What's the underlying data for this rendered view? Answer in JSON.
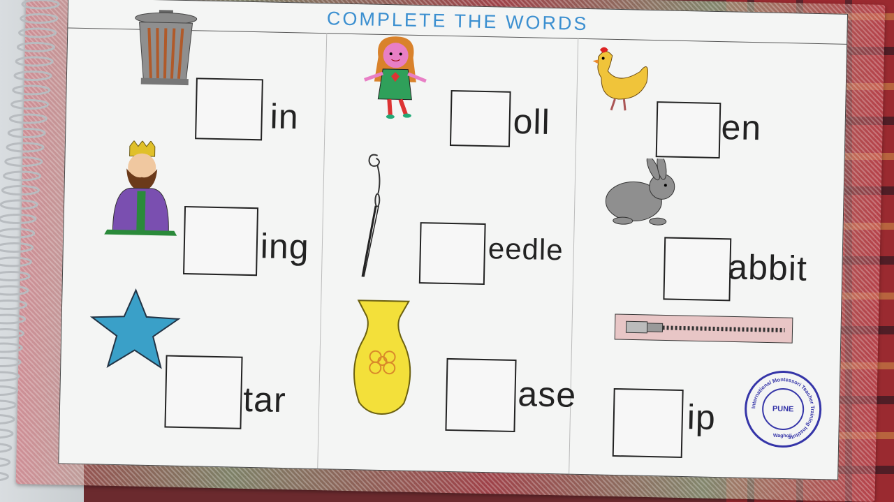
{
  "title": "COMPLETE THE WORDS",
  "items": [
    {
      "word": "in",
      "picture": "trash-bin"
    },
    {
      "word": "oll",
      "picture": "doll"
    },
    {
      "word": "en",
      "picture": "hen"
    },
    {
      "word": "ing",
      "picture": "king"
    },
    {
      "word": "eedle",
      "picture": "needle"
    },
    {
      "word": "abbit",
      "picture": "rabbit"
    },
    {
      "word": "tar",
      "picture": "star"
    },
    {
      "word": "ase",
      "picture": "vase"
    },
    {
      "word": "ip",
      "picture": "zip"
    }
  ],
  "stamp": {
    "center": "PUNE",
    "ring": "International Montessori Teacher Training Institute",
    "bottom": "Wagholi",
    "color": "#3535a8"
  },
  "colors": {
    "title": "#3b8fd0"
  }
}
